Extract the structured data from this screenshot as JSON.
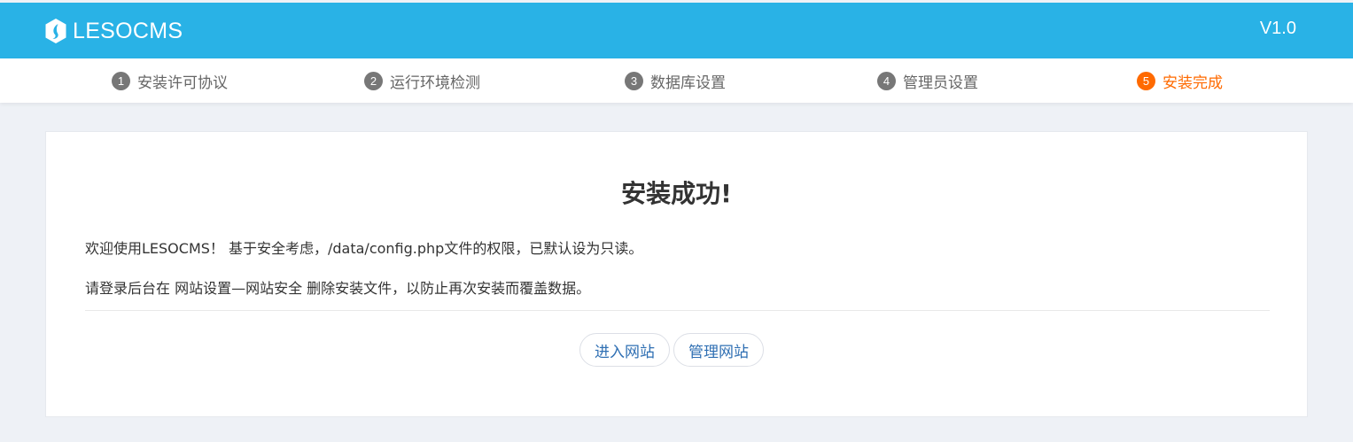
{
  "header": {
    "brand": "LESOCMS",
    "version": "V1.0",
    "bg_color": "#29b2e6",
    "logo_icon": "leso-logo-icon"
  },
  "steps": [
    {
      "num": "1",
      "label": "安装许可协议",
      "active": false
    },
    {
      "num": "2",
      "label": "运行环境检测",
      "active": false
    },
    {
      "num": "3",
      "label": "数据库设置",
      "active": false
    },
    {
      "num": "4",
      "label": "管理员设置",
      "active": false
    },
    {
      "num": "5",
      "label": "安装完成",
      "active": true
    }
  ],
  "colors": {
    "active_step": "#ff6a00",
    "link": "#2f6fb3"
  },
  "main": {
    "title": "安装成功!",
    "message1": "欢迎使用LESOCMS！ 基于安全考虑，/data/config.php文件的权限，已默认设为只读。",
    "message2": "请登录后台在 网站设置—网站安全 删除安装文件，以防止再次安装而覆盖数据。",
    "enter_site_label": "进入网站",
    "manage_site_label": "管理网站"
  }
}
